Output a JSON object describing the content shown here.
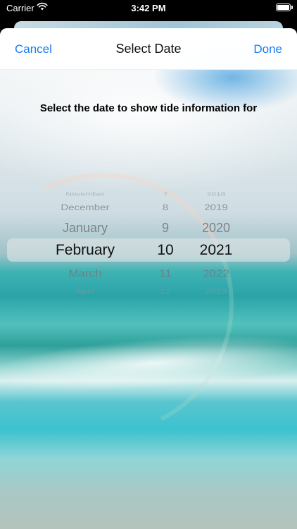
{
  "status_bar": {
    "carrier": "Carrier",
    "time": "3:42 PM"
  },
  "nav": {
    "cancel_label": "Cancel",
    "title": "Select Date",
    "done_label": "Done"
  },
  "prompt": "Select the date to show tide information for",
  "picker": {
    "months": [
      "November",
      "December",
      "January",
      "February",
      "March",
      "April"
    ],
    "days": [
      "7",
      "8",
      "9",
      "10",
      "11",
      "12"
    ],
    "years": [
      "2018",
      "2019",
      "2020",
      "2021",
      "2022",
      "2023"
    ],
    "selected": {
      "month": "February",
      "day": "10",
      "year": "2021"
    }
  },
  "colors": {
    "accent": "#1a7cf5",
    "title_text": "#111111"
  }
}
